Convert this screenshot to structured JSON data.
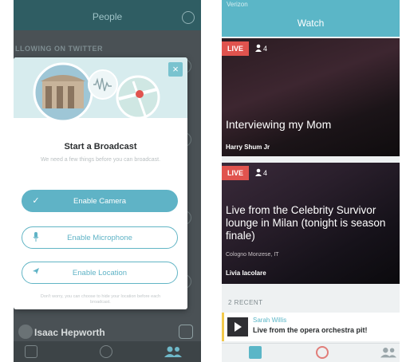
{
  "left_screen": {
    "header": {
      "title": "People"
    },
    "section_label": "LLOWING ON TWITTER",
    "modal": {
      "heading": "Start a Broadcast",
      "subtext": "We need a few things before you can broadcast.",
      "buttons": [
        {
          "label": "Enable Camera",
          "icon": "check-icon",
          "state": "enabled"
        },
        {
          "label": "Enable Microphone",
          "icon": "microphone-icon",
          "state": "pending"
        },
        {
          "label": "Enable Location",
          "icon": "location-arrow-icon",
          "state": "pending"
        }
      ],
      "fine_print": "Don't worry, you can choose to hide your location before each broadcast.",
      "close_glyph": "×"
    },
    "bottom_user": {
      "name": "Isaac Hepworth"
    }
  },
  "right_screen": {
    "status_bar": "Verizon",
    "header": {
      "title": "Watch"
    },
    "broadcasts": [
      {
        "badge": "LIVE",
        "viewers": "4",
        "caption": "Interviewing my Mom",
        "author": "Harry Shum Jr",
        "location": ""
      },
      {
        "badge": "LIVE",
        "viewers": "4",
        "caption": "Live from the Celebrity Survivor lounge in Milan (tonight is season finale)",
        "author": "Livia Iacolare",
        "location": "Cologno Monzese, IT"
      }
    ],
    "recent_section": {
      "label": "2 RECENT"
    },
    "recent_items": [
      {
        "author": "Sarah Willis",
        "title": "Live from the opera orchestra pit!"
      }
    ]
  },
  "colors": {
    "accent": "#5bb6c7",
    "live_red": "#e0534e",
    "recent_highlight": "#f2c94c",
    "dim_header": "#2f5d63"
  }
}
